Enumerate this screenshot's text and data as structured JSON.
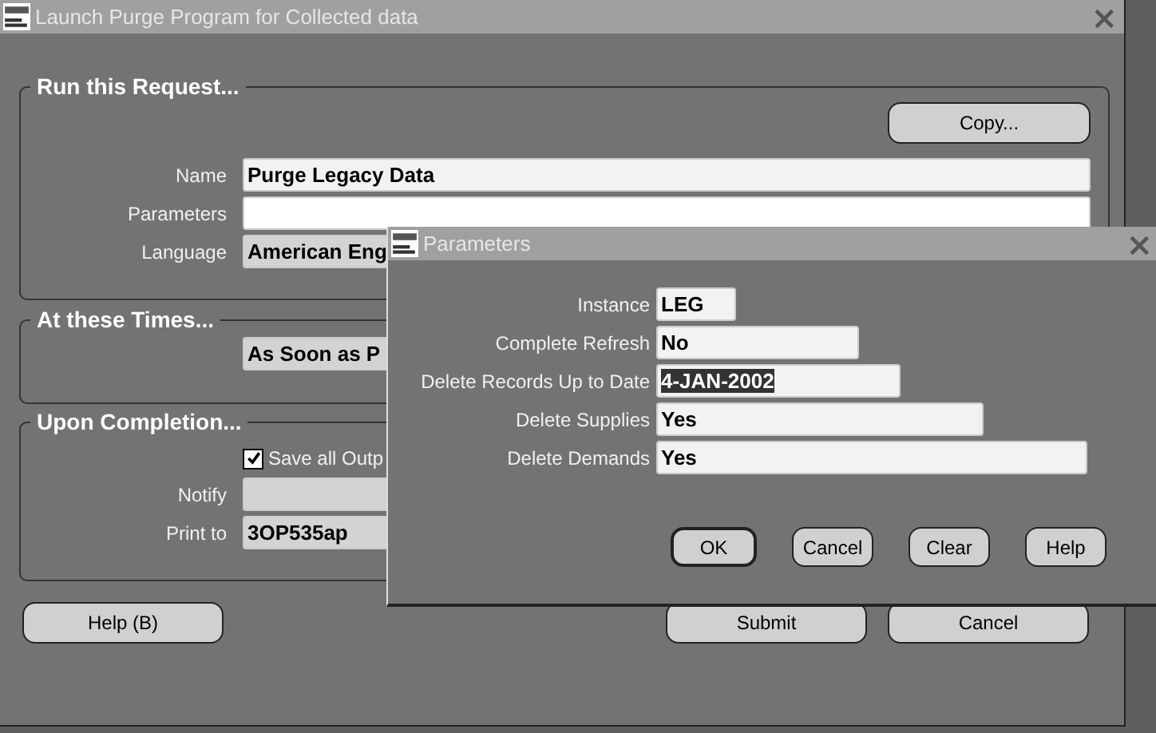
{
  "window": {
    "title": "Launch Purge Program for Collected data",
    "close": "×"
  },
  "run_request": {
    "heading": "Run this Request...",
    "copy_button": "Copy...",
    "fields": [
      {
        "label": "Name",
        "value": "Purge Legacy Data",
        "kind": "entry"
      },
      {
        "label": "Parameters",
        "kind": "current"
      },
      {
        "label": "Language",
        "value": "American Eng",
        "kind": "display"
      }
    ]
  },
  "schedule": {
    "heading": "At these Times...",
    "value": "As Soon as P"
  },
  "completion": {
    "heading": "Upon Completion...",
    "save_output": {
      "label": "Save all Outp",
      "checked": true
    },
    "fields": [
      {
        "label": "Notify",
        "kind": "display"
      },
      {
        "label": "Print to",
        "value": "3OP535ap",
        "kind": "display"
      }
    ]
  },
  "buttons": [
    {
      "label": "Help (B)"
    },
    {
      "label": "Submit"
    },
    {
      "label": "Cancel"
    }
  ],
  "dialog": {
    "title": "Parameters",
    "close": "×",
    "fields": [
      {
        "label": "Instance",
        "value": "LEG",
        "text_selected": false
      },
      {
        "label": "Complete Refresh",
        "value": "No",
        "text_selected": false
      },
      {
        "label": "Delete Records Up to Date",
        "value": "4-JAN-2002",
        "text_selected": true
      },
      {
        "label": "Delete Supplies",
        "value": "Yes",
        "text_selected": false
      },
      {
        "label": "Delete Demands",
        "value": "Yes",
        "text_selected": false
      }
    ],
    "buttons": [
      {
        "label": "OK",
        "default": true
      },
      {
        "label": "Cancel",
        "default": false
      },
      {
        "label": "Clear",
        "default": false
      },
      {
        "label": "Help",
        "default": false
      }
    ]
  }
}
